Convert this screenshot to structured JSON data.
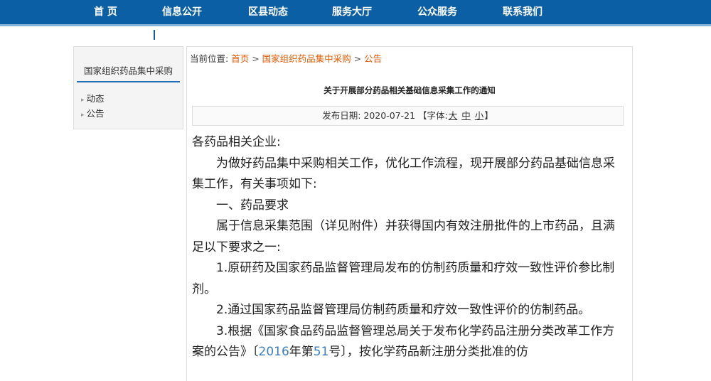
{
  "nav": {
    "items": [
      "首 页",
      "信息公开",
      "区县动态",
      "服务大厅",
      "公众服务",
      "联系我们"
    ]
  },
  "sidebar": {
    "title": "国家组织药品集中采购",
    "items": [
      "动态",
      "公告"
    ]
  },
  "breadcrumb": {
    "prefix": "当前位置:",
    "home": "首页",
    "sep1": ">",
    "category": "国家组织药品集中采购",
    "sep2": ">",
    "current": "公告"
  },
  "article": {
    "title": "关于开展部分药品相关基础信息采集工作的通知",
    "date_label": "发布日期:",
    "date": "2020-07-21",
    "font_label": "【字体:",
    "font_large": "大",
    "font_medium": "中",
    "font_small": "小",
    "font_close": "】",
    "greeting": "各药品相关企业:",
    "para1": "为做好药品集中采购相关工作，优化工作流程，现开展部分药品基础信息采集工作，有关事项如下:",
    "section1": "一、药品要求",
    "para2": "属于信息采集范围（详见附件）并获得国内有效注册批件的上市药品，且满足以下要求之一:",
    "item1": "1.原研药及国家药品监督管理局发布的仿制药质量和疗效一致性评价参比制剂。",
    "item2": "2.通过国家药品监督管理局仿制药质量和疗效一致性评价的仿制药品。",
    "item3_a": "3.根据《国家食品药品监督管理总局关于发布化学药品注册分类改革工作方案的公告》〔",
    "item3_year": "2016",
    "item3_b": "年第",
    "item3_num": "51",
    "item3_c": "号〕，按化学药品新注册分类批准的仿"
  },
  "colors": {
    "nav_bg": "#0b5fa4",
    "link": "#e05a00",
    "highlight": "#3a7fc1"
  }
}
